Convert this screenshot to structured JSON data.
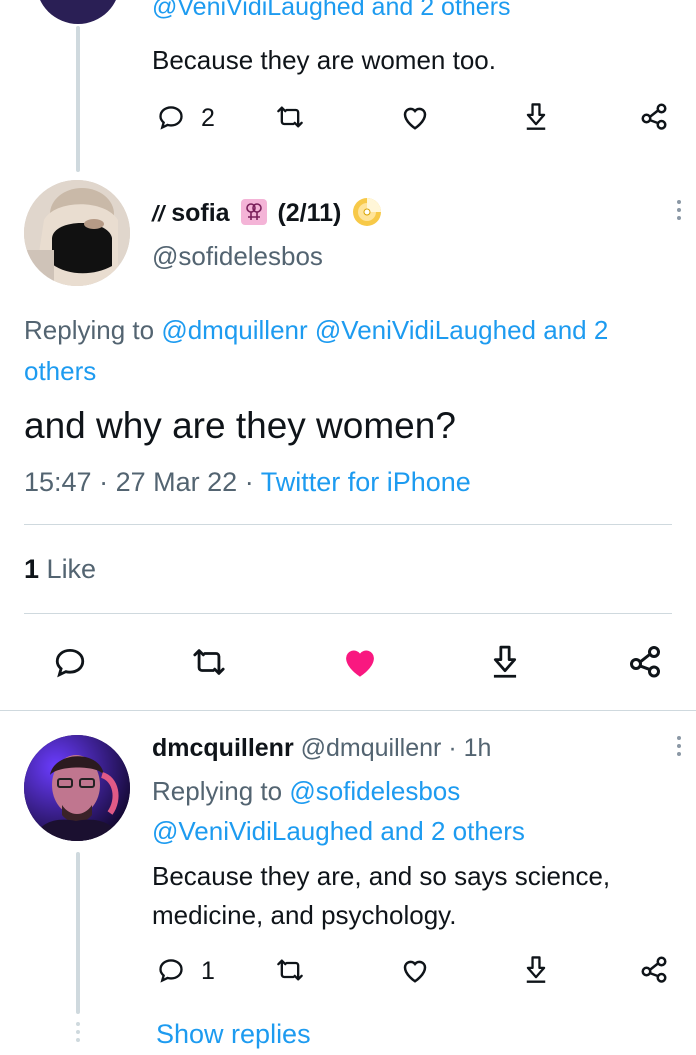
{
  "top_reply": {
    "replying_cut": "@VeniVidiLaughed and 2 others",
    "text": "Because they are women too.",
    "reply_count": "2"
  },
  "main_tweet": {
    "display_name_prefix": "//",
    "display_name": "sofia",
    "name_suffix": "(2/11)",
    "handle": "@sofidelesbos",
    "replying_prefix": "Replying to",
    "replying_to_1": "@dmquillenr",
    "replying_to_2": "@VeniVidiLaughed",
    "replying_others": "and 2 others",
    "text": "and why are they women?",
    "time": "15:47",
    "sep1": "·",
    "date": "27 Mar 22",
    "sep2": "·",
    "source": "Twitter for iPhone",
    "likes_count": "1",
    "likes_label": "Like",
    "liked": true,
    "colors": {
      "like_active": "#f91880"
    }
  },
  "reply": {
    "display_name": "dmcquillenr",
    "handle": "@dmquillenr",
    "sep": "·",
    "time_ago": "1h",
    "replying_prefix": "Replying to",
    "replying_to_1": "@sofidelesbos",
    "replying_to_2": "@VeniVidiLaughed",
    "replying_others": "and 2 others",
    "text": "Because they are, and so says science, medicine, and psychology.",
    "reply_count": "1"
  },
  "show_replies": "Show replies",
  "colors": {
    "accent": "#1d9bf0",
    "text": "#0f1419",
    "muted": "#536471",
    "divider": "#cfd9de"
  }
}
